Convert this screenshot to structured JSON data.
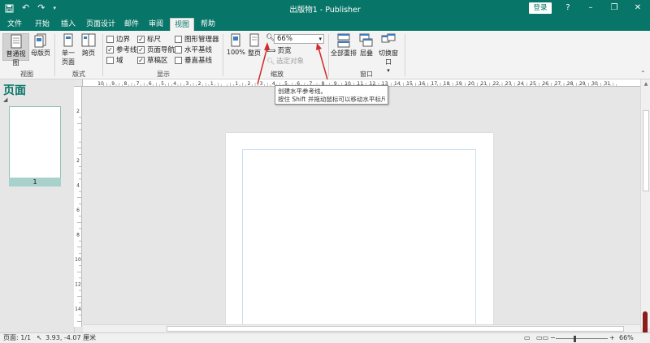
{
  "window": {
    "title": "出版物1 - Publisher",
    "login_label": "登录",
    "help_label": "?",
    "theme_color": "#077568"
  },
  "qat": {
    "save_icon": "save-icon",
    "undo_icon": "undo-icon",
    "redo_icon": "redo-icon",
    "customize_icon": "chevron-down-icon"
  },
  "tabs": [
    {
      "label": "文件"
    },
    {
      "label": "开始"
    },
    {
      "label": "插入"
    },
    {
      "label": "页面设计"
    },
    {
      "label": "邮件"
    },
    {
      "label": "审阅"
    },
    {
      "label": "视图"
    },
    {
      "label": "帮助"
    }
  ],
  "ribbon": {
    "views": {
      "normal_label": "普通视图",
      "master_label": "母版页",
      "group_label": "视图"
    },
    "layout": {
      "single_label": "单一",
      "single_label2": "页面",
      "spread_label": "跨页",
      "group_label": "版式"
    },
    "show": {
      "group_label": "显示",
      "checks": [
        {
          "label": "边界",
          "checked": false
        },
        {
          "label": "参考线",
          "checked": true
        },
        {
          "label": "域",
          "checked": false
        },
        {
          "label": "标尺",
          "checked": true
        },
        {
          "label": "页面导航",
          "checked": true
        },
        {
          "label": "草稿区",
          "checked": true
        },
        {
          "label": "图形管理器",
          "checked": false
        },
        {
          "label": "水平基线",
          "checked": false
        },
        {
          "label": "垂直基线",
          "checked": false
        }
      ]
    },
    "zoom": {
      "group_label": "缩放",
      "hundred_label": "100%",
      "whole_page_label": "整页",
      "zoom_value": "66%",
      "page_width_label": "页宽",
      "selected_objects_label": "选定对象"
    },
    "window": {
      "group_label": "窗口",
      "arrange_all_label": "全部重排",
      "cascade_label": "层叠",
      "switch_label": "切换窗口"
    }
  },
  "left_pane": {
    "title": "页面",
    "page_number": "1"
  },
  "ruler": {
    "h_labels": [
      "10",
      "9",
      "8",
      "7",
      "6",
      "5",
      "4",
      "3",
      "2",
      "1",
      "",
      "1",
      "2",
      "3",
      "4",
      "5",
      "6",
      "7",
      "8",
      "9",
      "10",
      "11",
      "12",
      "13",
      "14",
      "15",
      "16",
      "17",
      "18",
      "19",
      "20",
      "21",
      "22",
      "23",
      "24",
      "25",
      "26",
      "27",
      "28",
      "29",
      "30",
      "31"
    ],
    "v_labels": [
      "2",
      "",
      "2",
      "4",
      "6",
      "8",
      "10",
      "12",
      "14"
    ]
  },
  "tooltip": {
    "line1": "创建水平参考线。",
    "line2": "按住 Shift 并拖动鼠标可以移动水平标尺"
  },
  "status": {
    "page": "页面: 1/1",
    "position": "3.93, -4.07 厘米",
    "zoom": "66%"
  }
}
